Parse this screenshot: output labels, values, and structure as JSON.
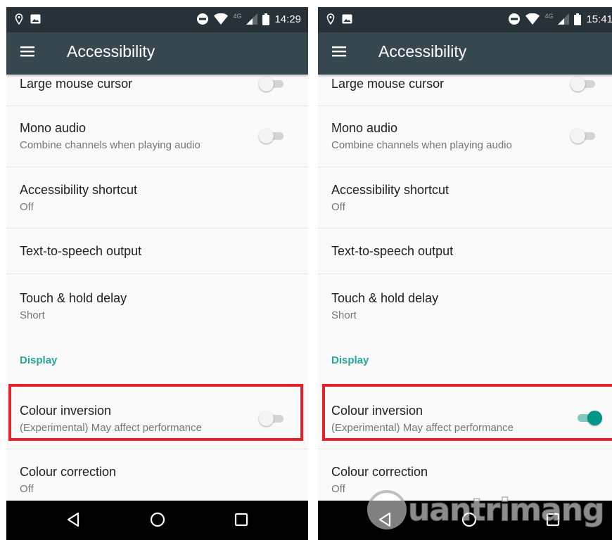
{
  "screens": [
    {
      "status": {
        "network": "4G",
        "time": "14:29"
      },
      "app_bar": {
        "title": "Accessibility"
      },
      "items": [
        {
          "title": "Large mouse cursor",
          "toggle": false
        },
        {
          "title": "Mono audio",
          "subtitle": "Combine channels when playing audio",
          "toggle": false
        },
        {
          "title": "Accessibility shortcut",
          "subtitle": "Off"
        },
        {
          "title": "Text-to-speech output"
        },
        {
          "title": "Touch & hold delay",
          "subtitle": "Short"
        },
        {
          "section": "Display"
        },
        {
          "title": "Colour inversion",
          "subtitle": "(Experimental) May affect performance",
          "toggle": false
        },
        {
          "title": "Colour correction",
          "subtitle": "Off"
        }
      ]
    },
    {
      "status": {
        "network": "4G",
        "time": "15:41"
      },
      "app_bar": {
        "title": "Accessibility"
      },
      "items": [
        {
          "title": "Large mouse cursor",
          "toggle": false
        },
        {
          "title": "Mono audio",
          "subtitle": "Combine channels when playing audio",
          "toggle": false
        },
        {
          "title": "Accessibility shortcut",
          "subtitle": "Off"
        },
        {
          "title": "Text-to-speech output"
        },
        {
          "title": "Touch & hold delay",
          "subtitle": "Short"
        },
        {
          "section": "Display"
        },
        {
          "title": "Colour inversion",
          "subtitle": "(Experimental) May affect performance",
          "toggle": true
        },
        {
          "title": "Colour correction",
          "subtitle": "Off"
        }
      ]
    }
  ],
  "watermark": "uantrimang",
  "icons": {
    "status_left": [
      "location-pin-icon",
      "image-icon"
    ],
    "status_right": [
      "do-not-disturb-icon",
      "wifi-icon",
      "cell-signal-icon",
      "battery-icon"
    ],
    "app_bar": "menu-icon",
    "nav": [
      "back-icon",
      "home-icon",
      "recents-icon"
    ]
  },
  "colors": {
    "status_bar": "#263238",
    "app_bar": "#37474f",
    "accent": "#009688",
    "section": "#26a69a",
    "highlight": "#e8202a"
  }
}
